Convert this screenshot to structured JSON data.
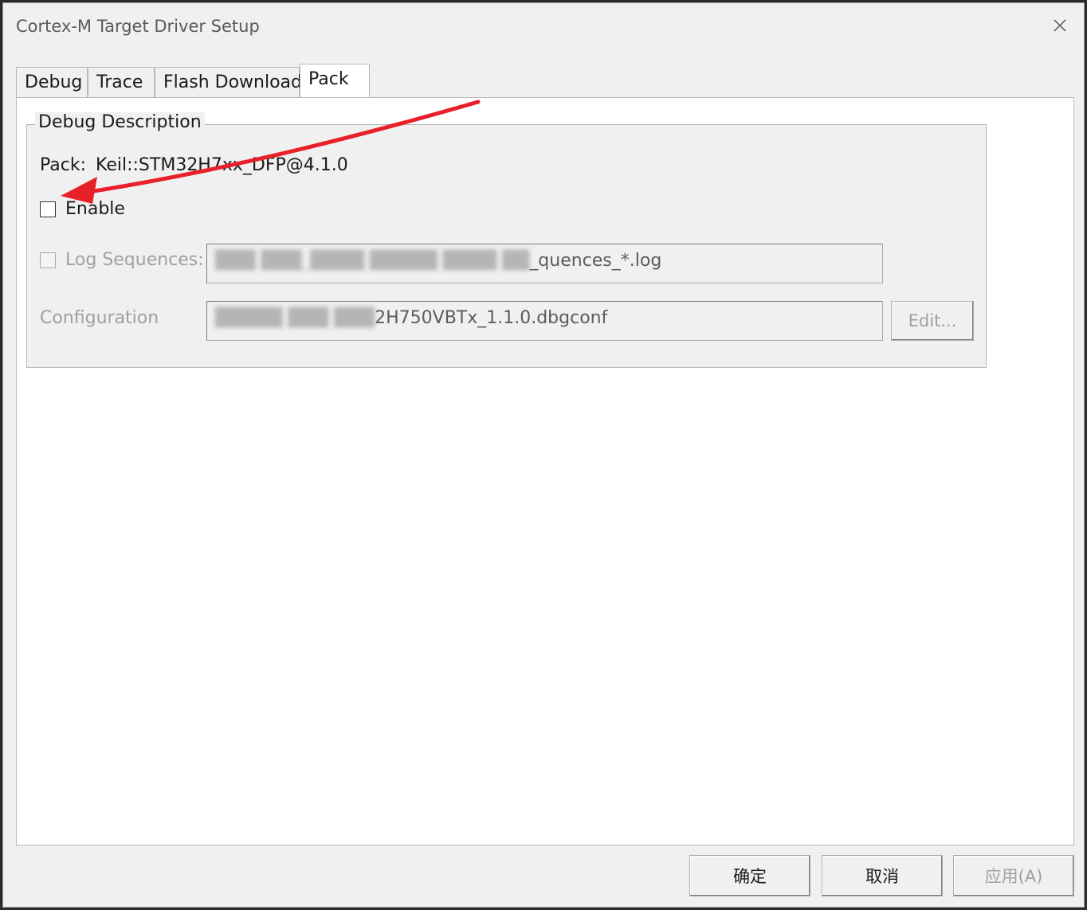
{
  "window": {
    "title": "Cortex-M Target Driver Setup"
  },
  "tabs": [
    {
      "label": "Debug",
      "active": false
    },
    {
      "label": "Trace",
      "active": false
    },
    {
      "label": "Flash Download",
      "active": false
    },
    {
      "label": "Pack",
      "active": true
    }
  ],
  "debug_description": {
    "group_title": "Debug Description",
    "pack_label": "Pack:",
    "pack_value": "Keil::STM32H7xx_DFP@4.1.0",
    "enable": {
      "label": "Enable",
      "checked": false
    },
    "log_sequences": {
      "label": "Log Sequences:",
      "checked": false,
      "enabled": false,
      "value_hidden": "███ ███_████ █████ ████ ██",
      "value_visible": "_quences_*.log"
    },
    "configuration": {
      "label": "Configuration",
      "value_hidden": "█████ ███ ███",
      "value_visible": "2H750VBTx_1.1.0.dbgconf",
      "edit_label": "Edit..."
    }
  },
  "footer": {
    "ok_label": "确定",
    "cancel_label": "取消",
    "apply_label": "应用(A)"
  },
  "annotation": {
    "arrow_color": "#e8202a"
  }
}
